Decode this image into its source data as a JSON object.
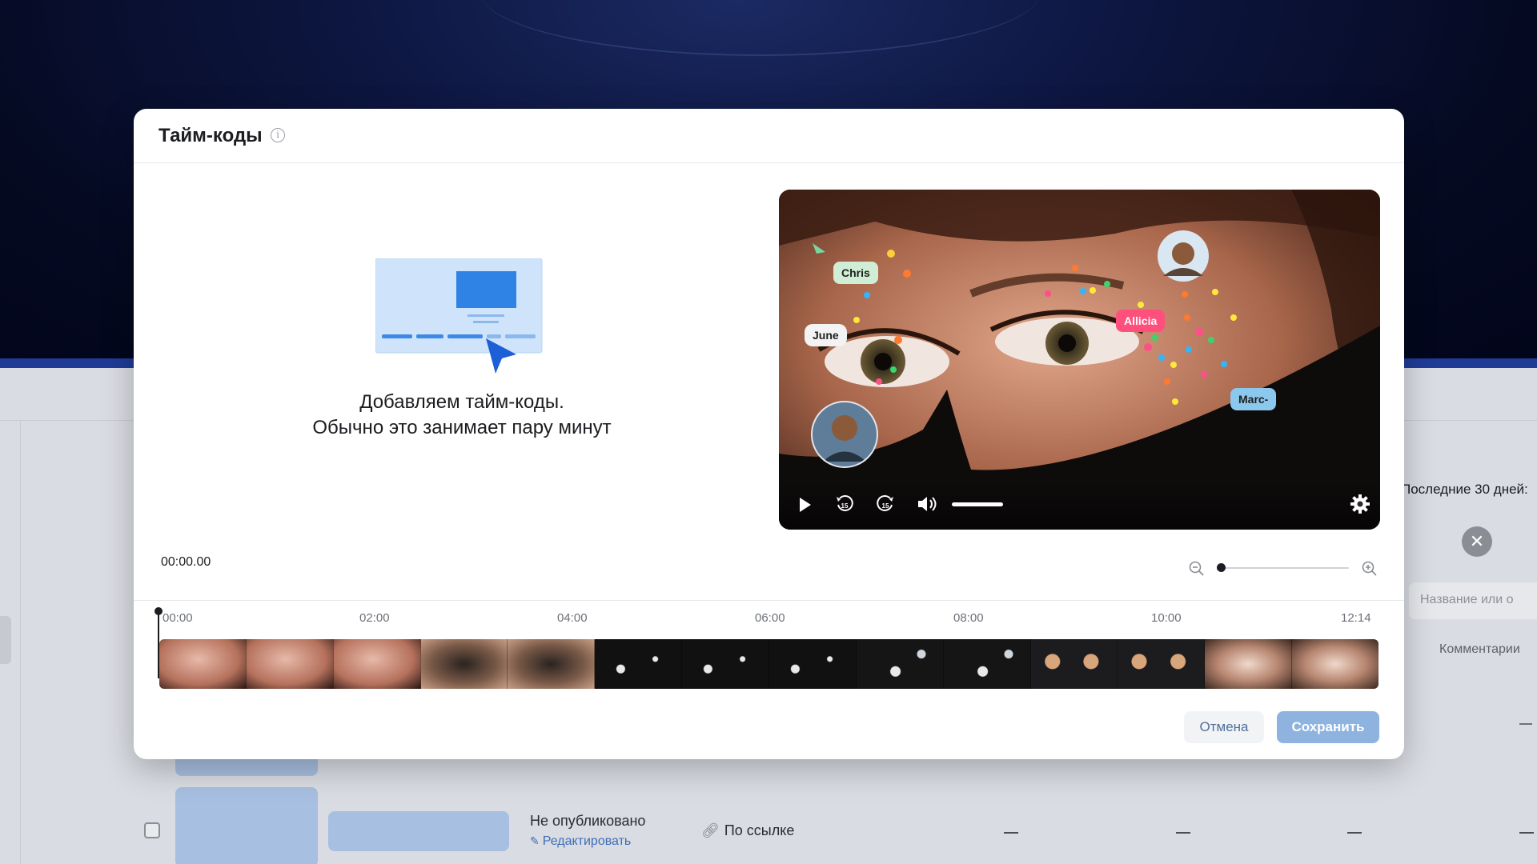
{
  "modal": {
    "title": "Тайм-коды",
    "info_icon": "info-icon",
    "loading_line1": "Добавляем тайм-коды.",
    "loading_line2": "Обычно это занимает пару минут",
    "timecode": "00:00.00",
    "zoom_level": 0,
    "ruler": [
      "00:00",
      "02:00",
      "04:00",
      "06:00",
      "08:00",
      "10:00",
      "12:14"
    ],
    "cancel_label": "Отмена",
    "save_label": "Сохранить"
  },
  "video": {
    "bubbles": [
      "Chris",
      "June",
      "Allicia",
      "Marc-"
    ],
    "controls": [
      "play-icon",
      "rewind-15-icon",
      "forward-15-icon",
      "volume-icon",
      "settings-gear-icon"
    ],
    "volume_level": 1.0
  },
  "background": {
    "period_label": "Последние 30 дней:",
    "search_placeholder": "Название или о",
    "comments_label": "Комментарии",
    "row": {
      "status": "Не опубликовано",
      "edit_label": "Редактировать",
      "access": "По ссылке",
      "dashes": [
        "—",
        "—",
        "—",
        "—"
      ]
    }
  },
  "colors": {
    "accent": "#2d81e0",
    "save_button": "#8eb3de",
    "cancel_text": "#4f6f9e",
    "link": "#3f6db7",
    "hero_bg": "#050a22"
  }
}
